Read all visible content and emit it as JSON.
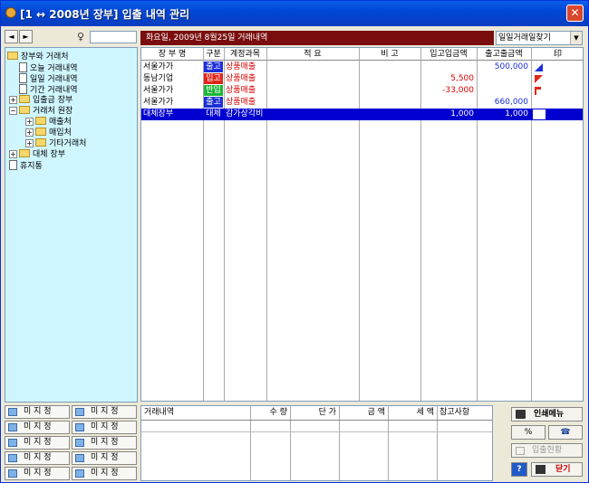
{
  "window": {
    "title": "[1 ↔ 2008년 장부] 입출 내역 관리",
    "close_label": "✕"
  },
  "nav": {
    "prev": "◄",
    "next": "►",
    "search_icon": "♀",
    "search_value": ""
  },
  "tree": [
    {
      "label": "장부와 거래처",
      "type": "folder"
    },
    {
      "label": "오늘 거래내역",
      "type": "doc"
    },
    {
      "label": "일일 거래내역",
      "type": "doc"
    },
    {
      "label": "기간 거래내역",
      "type": "doc"
    },
    {
      "label": "입출금 장부",
      "type": "folder",
      "expander": "+"
    },
    {
      "label": "거래처 원장",
      "type": "folder",
      "expander": "−"
    },
    {
      "label": "매출처",
      "type": "folder",
      "expander": "+"
    },
    {
      "label": "매입처",
      "type": "folder",
      "expander": "+"
    },
    {
      "label": "기타거래처",
      "type": "folder",
      "expander": "+"
    },
    {
      "label": "대체 장부",
      "type": "folder",
      "expander": "+"
    },
    {
      "label": "휴지통",
      "type": "doc"
    }
  ],
  "header": {
    "title": "화요일, 2009년 8월25일 거래내역",
    "find_select": "일일거래일찾기",
    "find_arrow": "▼"
  },
  "grid": {
    "columns": [
      "장 부 명",
      "구분",
      "계정과목",
      "적 요",
      "비 고",
      "입고입금액",
      "출고출금액",
      "印"
    ],
    "rows": [
      {
        "book": "서울가가",
        "type": "출고",
        "type_color": "#1B2FD8",
        "account": "상품매출",
        "income": "",
        "outgo": "500,000",
        "mark": "blue"
      },
      {
        "book": "동남기업",
        "type": "입고",
        "type_color": "#E0261A",
        "account": "상품매출",
        "income": "5,500",
        "outgo": "",
        "mark": "red"
      },
      {
        "book": "서울가가",
        "type": "반입",
        "type_color": "#1DB73A",
        "account": "상품매출",
        "income": "-33,000",
        "outgo": "",
        "mark": "flag"
      },
      {
        "book": "서울가가",
        "type": "출고",
        "type_color": "#1B2FD8",
        "account": "상품매출",
        "income": "",
        "outgo": "660,000",
        "mark": ""
      },
      {
        "book": "대체장부",
        "type": "대체",
        "type_color": "#0000D0",
        "account": "감가상각비",
        "income": "1,000",
        "outgo": "1,000",
        "mark": "",
        "selected": true
      }
    ]
  },
  "misc_buttons": [
    "미 지 정",
    "미 지 정",
    "미 지 정",
    "미 지 정",
    "미 지 정",
    "미 지 정",
    "미 지 정",
    "미 지 정",
    "미 지 정",
    "미 지 정"
  ],
  "detail": {
    "columns": [
      "거래내역",
      "수 량",
      "단 가",
      "금 액",
      "세 액",
      "참고사항"
    ]
  },
  "actions": {
    "print": "인쇄메뉴",
    "percent": "%",
    "phone": "☎",
    "summary": "입출현황",
    "help": "?",
    "close": "닫기"
  }
}
